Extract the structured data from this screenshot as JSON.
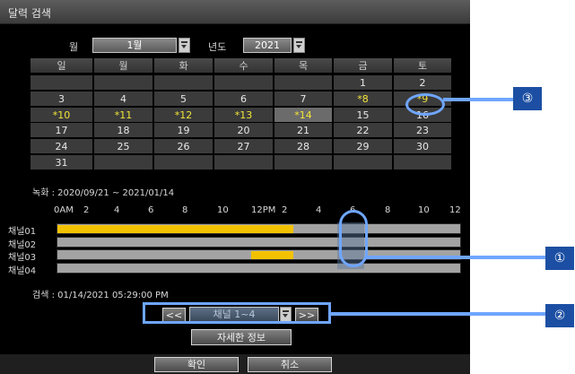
{
  "window": {
    "title": "달력 검색"
  },
  "month": {
    "label": "월",
    "value": "1월"
  },
  "year": {
    "label": "년도",
    "value": "2021"
  },
  "calendar": {
    "weekdays": [
      "일",
      "월",
      "화",
      "수",
      "목",
      "금",
      "토"
    ],
    "rows": [
      [
        "",
        "",
        "",
        "",
        "",
        "1",
        "2"
      ],
      [
        "3",
        "4",
        "5",
        "6",
        "7",
        "*8",
        "*9"
      ],
      [
        "*10",
        "*11",
        "*12",
        "*13",
        "*14",
        "15",
        "16"
      ],
      [
        "17",
        "18",
        "19",
        "20",
        "21",
        "22",
        "23"
      ],
      [
        "24",
        "25",
        "26",
        "27",
        "28",
        "29",
        "30"
      ],
      [
        "31",
        "",
        "",
        "",
        "",
        "",
        ""
      ]
    ],
    "selected_day": "*14",
    "record_color": "#f3e43a"
  },
  "record_range": "녹화 : 2020/09/21 ~ 2021/01/14",
  "timeline": {
    "hour_labels": [
      "0AM",
      "2",
      "4",
      "6",
      "8",
      "10",
      "12PM",
      "2",
      "4",
      "6",
      "8",
      "10",
      "12"
    ],
    "channels": [
      {
        "name": "채널01",
        "segments": [
          [
            0,
            14
          ]
        ]
      },
      {
        "name": "채널02",
        "segments": []
      },
      {
        "name": "채널03",
        "segments": [
          [
            11.5,
            14
          ]
        ]
      },
      {
        "name": "채널04",
        "segments": []
      }
    ],
    "bar_color": "#f2c200",
    "search_time": "검색 : 01/14/2021 05:29:00 PM"
  },
  "channel_nav": {
    "prev": "<<",
    "next": ">>",
    "value": "채널 1~4"
  },
  "detail_button": "자세한 정보",
  "ok_button": "확인",
  "cancel_button": "취소",
  "callouts": {
    "one": "①",
    "two": "②",
    "three": "③"
  },
  "accent_color": "#6fa6ff"
}
